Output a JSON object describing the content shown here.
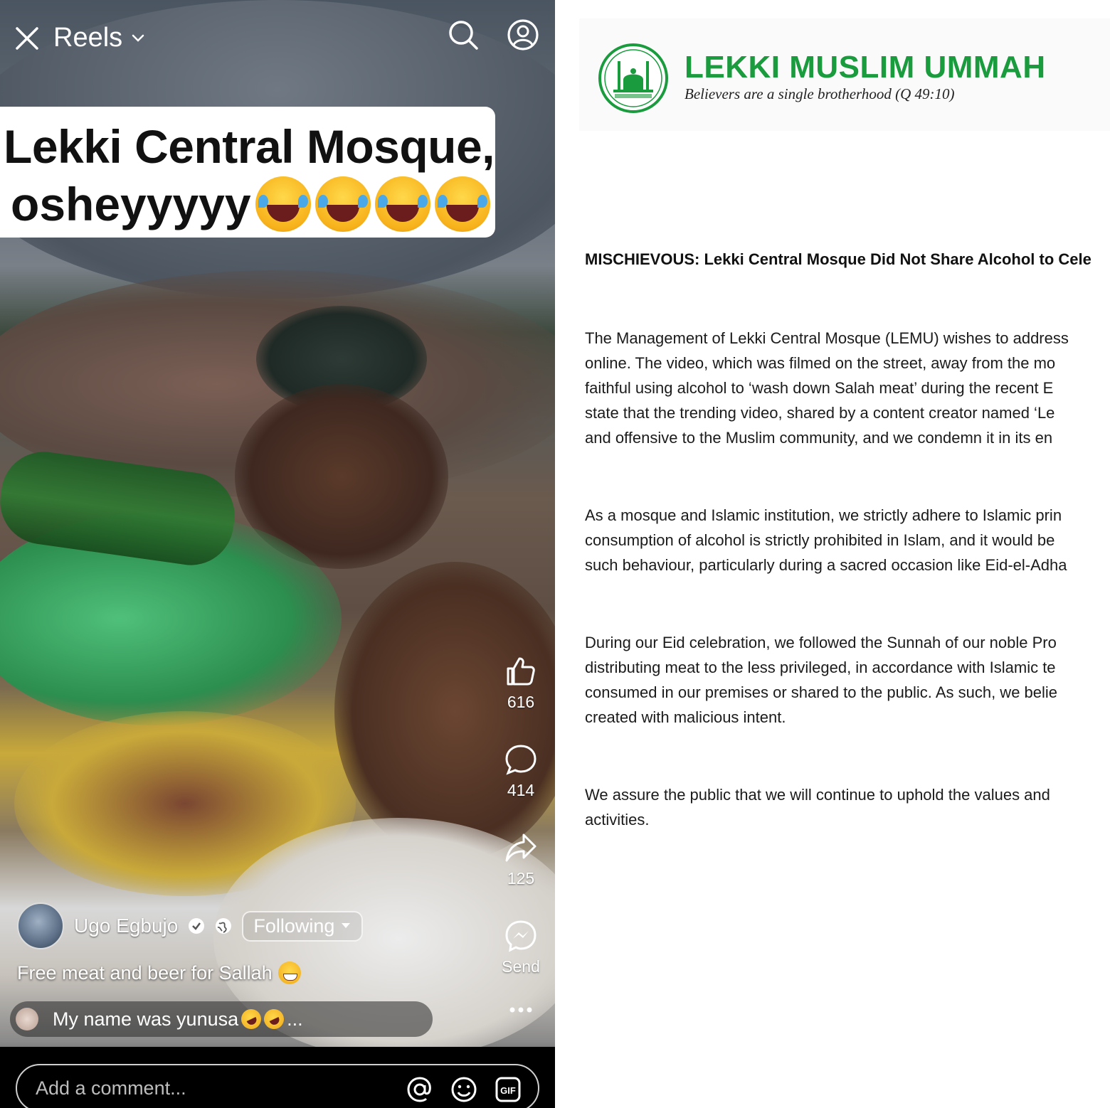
{
  "reels": {
    "title": "Reels",
    "overlay_caption": {
      "line1": "Lekki Central Mosque,",
      "line2": "osheyyyyy"
    },
    "actions": {
      "likes": "616",
      "comments": "414",
      "shares": "125",
      "send_label": "Send"
    },
    "author": {
      "name": "Ugo Egbujo",
      "follow_label": "Following"
    },
    "post_caption": "Free meat and beer for Sallah",
    "top_comment": "My name was yunusa",
    "top_comment_suffix": "...",
    "comment_input_placeholder": "Add a comment...",
    "icons": [
      "close-icon",
      "chevron-down-icon",
      "search-icon",
      "profile-icon",
      "like-icon",
      "comment-icon",
      "share-icon",
      "messenger-icon",
      "more-icon",
      "mention-icon",
      "emoji-icon",
      "gif-icon"
    ]
  },
  "document": {
    "org_name": "LEKKI MUSLIM UMMAH",
    "motto": "Believers are a single brotherhood (Q 49:10)",
    "brand_color": "#1a9b3e",
    "headline": "MISCHIEVOUS: Lekki Central Mosque Did Not Share Alcohol to Cele",
    "paragraphs": [
      [
        "The Management of Lekki Central Mosque (LEMU) wishes to address",
        "online. The video, which was filmed on the street, away from the mo",
        "faithful using alcohol to ‘wash down Salah meat’ during the recent E",
        "state that the trending video, shared by a content creator named ‘Le",
        "and offensive to the Muslim community, and we condemn it in its en"
      ],
      [
        "As a mosque and Islamic institution, we strictly adhere to Islamic prin",
        "consumption of alcohol is strictly prohibited in Islam, and it would be",
        "such behaviour, particularly during a sacred occasion like Eid-el-Adha"
      ],
      [
        "During our Eid celebration, we followed the Sunnah of our noble Pro",
        "distributing meat to the less privileged, in accordance with Islamic te",
        "consumed in our premises or shared to the public. As such, we belie",
        "created with malicious intent."
      ],
      [
        "We assure the public that we will continue to uphold the values and",
        "activities."
      ]
    ]
  }
}
